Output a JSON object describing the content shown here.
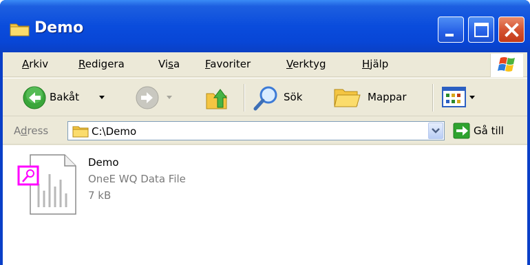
{
  "window": {
    "title": "Demo",
    "icon": "folder-icon"
  },
  "titlebar_buttons": [
    "minimize-icon",
    "maximize-icon",
    "close-icon"
  ],
  "menu": {
    "items": [
      {
        "label": "Arkiv",
        "underline_index": 0
      },
      {
        "label": "Redigera",
        "underline_index": 0
      },
      {
        "label": "Visa",
        "underline_index": 2
      },
      {
        "label": "Favoriter",
        "underline_index": 0
      },
      {
        "label": "Verktyg",
        "underline_index": 0
      },
      {
        "label": "Hjälp",
        "underline_index": 0
      }
    ]
  },
  "toolbar": {
    "back_label": "Bakåt",
    "search_label": "Sök",
    "folders_label": "Mappar"
  },
  "address": {
    "label": "Adress",
    "value": "C:\\Demo",
    "go_label": "Gå till"
  },
  "files": [
    {
      "name": "Demo",
      "type": "OneE WQ Data File",
      "size": "7 kB",
      "icon": "data-file-icon"
    }
  ],
  "colors": {
    "titlebar": "#0a4cdc",
    "close_button": "#d55432",
    "chrome": "#ece9d8",
    "go_arrow": "#2fa32f",
    "file_badge": "#ff00ff"
  }
}
